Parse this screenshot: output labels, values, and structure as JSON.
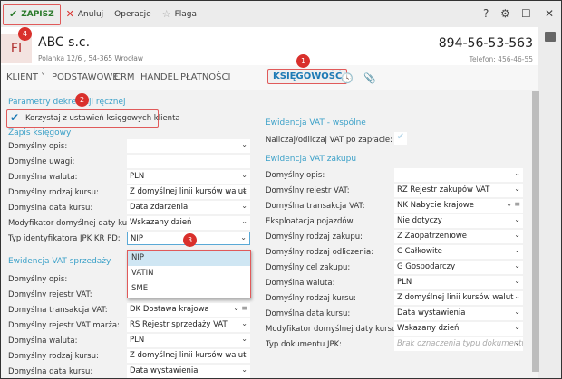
{
  "toolbar": {
    "save": "ZAPISZ",
    "cancel": "Anuluj",
    "operations": "Operacje",
    "flag": "Flaga"
  },
  "header": {
    "logo": "FI",
    "company": "ABC s.c.",
    "address": "Polanka  12/6 , 54-365 Wrocław",
    "nip": "894-56-53-563",
    "phone": "Telefon: 456-46-55"
  },
  "tabs": [
    "KLIENT",
    "PODSTAWOWE",
    "CRM",
    "HANDEL",
    "PŁATNOŚCI",
    "KSIĘGOWOŚĆ"
  ],
  "badges": [
    "1",
    "2",
    "3",
    "4"
  ],
  "left": {
    "section1": "Parametry dekretacji ręcznej",
    "checkbox_label": "Korzystaj z ustawień księgowych klienta",
    "section2": "Zapis księgowy",
    "rows": [
      {
        "label": "Domyślny opis:",
        "value": "",
        "dd": true
      },
      {
        "label": "Domyślne uwagi:",
        "value": "",
        "dd": false
      },
      {
        "label": "Domyślna waluta:",
        "value": "PLN",
        "dd": true
      },
      {
        "label": "Domyślny rodzaj kursu:",
        "value": "Z domyślnej linii kursów walut",
        "dd": true
      },
      {
        "label": "Domyślna data kursu:",
        "value": "Data zdarzenia",
        "dd": true
      },
      {
        "label": "Modyfikator domyślnej daty kursu:",
        "value": "Wskazany dzień",
        "dd": true
      },
      {
        "label": "Typ identyfikatora JPK KR PD:",
        "value": "NIP",
        "dd": true
      }
    ],
    "dropdown_options": [
      "NIP",
      "VATIN",
      "SME"
    ],
    "section3": "Ewidencja VAT sprzedaży",
    "rows2": [
      {
        "label": "Domyślny opis:",
        "value": ""
      },
      {
        "label": "Domyślny rejestr VAT:",
        "value": ""
      },
      {
        "label": "Domyślna transakcja VAT:",
        "value": "DK   Dostawa krajowa",
        "menu": true
      },
      {
        "label": "Domyślny rejestr VAT marża:",
        "value": "RS   Rejestr sprzedaży VAT"
      },
      {
        "label": "Domyślna waluta:",
        "value": "PLN"
      },
      {
        "label": "Domyślny rodzaj kursu:",
        "value": "Z domyślnej linii kursów walut"
      },
      {
        "label": "Domyślna data kursu:",
        "value": "Data wystawienia"
      }
    ]
  },
  "right": {
    "section1": "Ewidencja VAT - wspólne",
    "vat_after_payment": "Naliczaj/odliczaj VAT po zapłacie:",
    "section2": "Ewidencja VAT zakupu",
    "rows": [
      {
        "label": "Domyślny opis:",
        "value": ""
      },
      {
        "label": "Domyślny rejestr VAT:",
        "value": "RZ   Rejestr zakupów VAT"
      },
      {
        "label": "Domyślna transakcja VAT:",
        "value": "NK   Nabycie krajowe",
        "menu": true
      },
      {
        "label": "Eksploatacja pojazdów:",
        "value": "Nie dotyczy"
      },
      {
        "label": "Domyślny rodzaj zakupu:",
        "value": "Z  Zaopatrzeniowe"
      },
      {
        "label": "Domyślny rodzaj odliczenia:",
        "value": "C  Całkowite"
      },
      {
        "label": "Domyślny cel zakupu:",
        "value": "G  Gospodarczy"
      },
      {
        "label": "Domyślna waluta:",
        "value": "PLN"
      },
      {
        "label": "Domyślny rodzaj kursu:",
        "value": "Z domyślnej linii kursów walut"
      },
      {
        "label": "Domyślna data kursu:",
        "value": "Data wystawienia"
      },
      {
        "label": "Modyfikator domyślnej daty kursu:",
        "value": "Wskazany dzień"
      },
      {
        "label": "Typ dokumentu JPK:",
        "value": "",
        "placeholder": "Brak oznaczenia typu dokumentu"
      }
    ]
  },
  "colors": {
    "accent": "#1d7ab5",
    "section": "#3aa0c8",
    "highlight": "#e05a5a",
    "badge": "#d9302c"
  }
}
